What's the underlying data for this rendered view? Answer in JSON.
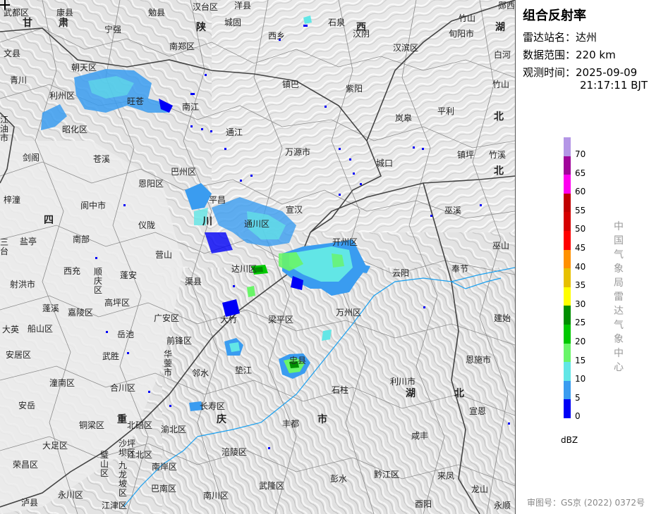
{
  "panel": {
    "title": "组合反射率",
    "station_label": "雷达站名：",
    "station_value": "达州",
    "range_label": "数据范围：",
    "range_value": "220 km",
    "time_label": "观测时间：",
    "time_date": "2025-09-09",
    "time_clock": "21:17:11 BJT",
    "unit": "dBZ",
    "org_vertical": "中国气象局雷达气象中心",
    "approval": "审图号：GS京 (2022) 0372号"
  },
  "legend": [
    {
      "label": "70",
      "color": "#b496e6"
    },
    {
      "label": "65",
      "color": "#a0059a"
    },
    {
      "label": "60",
      "color": "#ff00f0"
    },
    {
      "label": "55",
      "color": "#c00000"
    },
    {
      "label": "50",
      "color": "#d60000"
    },
    {
      "label": "45",
      "color": "#ff0000"
    },
    {
      "label": "40",
      "color": "#ff9000"
    },
    {
      "label": "35",
      "color": "#e7c000"
    },
    {
      "label": "30",
      "color": "#ffff00"
    },
    {
      "label": "25",
      "color": "#008e00"
    },
    {
      "label": "20",
      "color": "#00c800"
    },
    {
      "label": "15",
      "color": "#69f568"
    },
    {
      "label": "10",
      "color": "#62e6e6"
    },
    {
      "label": "5",
      "color": "#3a9cf0"
    },
    {
      "label": "0",
      "color": "#0000f6"
    }
  ],
  "map": {
    "province_labels": [
      {
        "id": "gan",
        "text": "甘"
      },
      {
        "id": "su",
        "text": "肃"
      },
      {
        "id": "shan",
        "text": "陕"
      },
      {
        "id": "xi",
        "text": "西"
      },
      {
        "id": "hu1",
        "text": "湖"
      },
      {
        "id": "bei1",
        "text": "北"
      },
      {
        "id": "bei2",
        "text": "北"
      },
      {
        "id": "si",
        "text": "四"
      },
      {
        "id": "chuan",
        "text": "川"
      },
      {
        "id": "hu2",
        "text": "湖"
      },
      {
        "id": "bei3",
        "text": "北"
      },
      {
        "id": "chong",
        "text": "重"
      },
      {
        "id": "qing",
        "text": "庆"
      },
      {
        "id": "shi",
        "text": "市"
      }
    ],
    "city_labels": [
      {
        "id": "wudu",
        "text": "武都区"
      },
      {
        "id": "kangxian",
        "text": "康县"
      },
      {
        "id": "mianxian",
        "text": "勉县"
      },
      {
        "id": "hantai",
        "text": "汉台区"
      },
      {
        "id": "yangxian",
        "text": "洋县"
      },
      {
        "id": "yunxi",
        "text": "郧西"
      },
      {
        "id": "ningqiang",
        "text": "宁强"
      },
      {
        "id": "chenggu",
        "text": "城固"
      },
      {
        "id": "shiquan",
        "text": "石泉"
      },
      {
        "id": "xunyang",
        "text": "旬阳市"
      },
      {
        "id": "wenxian",
        "text": "文县"
      },
      {
        "id": "nanzheng",
        "text": "南郑区"
      },
      {
        "id": "xixiang",
        "text": "西乡"
      },
      {
        "id": "hanyin",
        "text": "汉阴"
      },
      {
        "id": "hanbin",
        "text": "汉滨区"
      },
      {
        "id": "baihe",
        "text": "白河"
      },
      {
        "id": "qingchuan",
        "text": "青川"
      },
      {
        "id": "chaotian",
        "text": "朝天区"
      },
      {
        "id": "zhuxi",
        "text": "竹山"
      },
      {
        "id": "lizhou",
        "text": "利州区"
      },
      {
        "id": "wangcang",
        "text": "旺苍"
      },
      {
        "id": "nanjiang",
        "text": "南江"
      },
      {
        "id": "zhenba",
        "text": "镇巴"
      },
      {
        "id": "ziyang",
        "text": "紫阳"
      },
      {
        "id": "pingli",
        "text": "平利"
      },
      {
        "id": "zhaohua",
        "text": "昭化区"
      },
      {
        "id": "tongjiang",
        "text": "通江"
      },
      {
        "id": "langao",
        "text": "岚皋"
      },
      {
        "id": "jiangyou",
        "text": "江油市"
      },
      {
        "id": "jiange",
        "text": "剑阁"
      },
      {
        "id": "cangxi",
        "text": "苍溪"
      },
      {
        "id": "wanyuan",
        "text": "万源市"
      },
      {
        "id": "zhenping",
        "text": "镇坪"
      },
      {
        "id": "zhuxi2",
        "text": "竹溪"
      },
      {
        "id": "bazhou",
        "text": "巴州区"
      },
      {
        "id": "chengkou",
        "text": "城口"
      },
      {
        "id": "enyang",
        "text": "恩阳区"
      },
      {
        "id": "zitong",
        "text": "梓潼"
      },
      {
        "id": "langzhong",
        "text": "阆中市"
      },
      {
        "id": "pingchang",
        "text": "平昌"
      },
      {
        "id": "xuanhan",
        "text": "宣汉"
      },
      {
        "id": "wuxi",
        "text": "巫溪"
      },
      {
        "id": "yanting",
        "text": "盐亭"
      },
      {
        "id": "nanbu",
        "text": "南部"
      },
      {
        "id": "yilong",
        "text": "仪陇"
      },
      {
        "id": "tongchuan",
        "text": "通川区"
      },
      {
        "id": "kaizhou",
        "text": "开州区"
      },
      {
        "id": "wushan",
        "text": "巫山"
      },
      {
        "id": "santai",
        "text": "三台"
      },
      {
        "id": "yingshan",
        "text": "营山"
      },
      {
        "id": "dachuan",
        "text": "达川区"
      },
      {
        "id": "yunyang",
        "text": "云阳"
      },
      {
        "id": "fengjie",
        "text": "奉节"
      },
      {
        "id": "xichong",
        "text": "西充"
      },
      {
        "id": "shunqing",
        "text": "顺庆区"
      },
      {
        "id": "penggan",
        "text": "蓬安"
      },
      {
        "id": "quxian",
        "text": "渠县"
      },
      {
        "id": "shehong",
        "text": "射洪市"
      },
      {
        "id": "gaoping",
        "text": "高坪区"
      },
      {
        "id": "wanzhou",
        "text": "万州区"
      },
      {
        "id": "jianshi",
        "text": "建始"
      },
      {
        "id": "pengxi",
        "text": "蓬溪"
      },
      {
        "id": "jialing",
        "text": "嘉陵区"
      },
      {
        "id": "guang-an",
        "text": "广安区"
      },
      {
        "id": "dazhu",
        "text": "大竹"
      },
      {
        "id": "liangping",
        "text": "梁平区"
      },
      {
        "id": "daying",
        "text": "大英"
      },
      {
        "id": "chuanshan",
        "text": "船山区"
      },
      {
        "id": "yuechi",
        "text": "岳池"
      },
      {
        "id": "qianfeng",
        "text": "前锋区"
      },
      {
        "id": "anju",
        "text": "安居区"
      },
      {
        "id": "wusheng",
        "text": "武胜"
      },
      {
        "id": "huaying",
        "text": "华蓥市"
      },
      {
        "id": "linshui",
        "text": "邻水"
      },
      {
        "id": "dianjiang",
        "text": "垫江"
      },
      {
        "id": "zhongxian",
        "text": "忠县"
      },
      {
        "id": "enshi",
        "text": "恩施市"
      },
      {
        "id": "tongnan",
        "text": "潼南区"
      },
      {
        "id": "hechuan",
        "text": "合川区"
      },
      {
        "id": "shizhu",
        "text": "石柱"
      },
      {
        "id": "lichuan",
        "text": "利川市"
      },
      {
        "id": "anyue",
        "text": "安岳"
      },
      {
        "id": "changshou",
        "text": "长寿区"
      },
      {
        "id": "xuanen",
        "text": "宣恩"
      },
      {
        "id": "tongliang",
        "text": "铜梁区"
      },
      {
        "id": "beibei",
        "text": "北碚区"
      },
      {
        "id": "fengdu",
        "text": "丰都"
      },
      {
        "id": "xianfeng",
        "text": "咸丰"
      },
      {
        "id": "yubei",
        "text": "渝北区"
      },
      {
        "id": "dazu",
        "text": "大足区"
      },
      {
        "id": "shapingba",
        "text": "沙坪坝区"
      },
      {
        "id": "rongchang",
        "text": "荣昌区"
      },
      {
        "id": "bishan",
        "text": "璧山区"
      },
      {
        "id": "jiulongpo",
        "text": "九龙坡区"
      },
      {
        "id": "fuling",
        "text": "涪陵区"
      },
      {
        "id": "qianjiang",
        "text": "黔江区"
      },
      {
        "id": "laifeng",
        "text": "来凤"
      },
      {
        "id": "nanan",
        "text": "南岸区"
      },
      {
        "id": "wulong",
        "text": "武隆区"
      },
      {
        "id": "pengshui",
        "text": "彭水"
      },
      {
        "id": "longshan",
        "text": "龙山"
      },
      {
        "id": "yongchuan",
        "text": "永川区"
      },
      {
        "id": "banan",
        "text": "巴南区"
      },
      {
        "id": "nanchuan",
        "text": "南川区"
      },
      {
        "id": "youyang",
        "text": "酉阳"
      },
      {
        "id": "jiangjin",
        "text": "江津区"
      },
      {
        "id": "luxian",
        "text": "泸县"
      },
      {
        "id": "yongshun",
        "text": "永顺"
      },
      {
        "id": "zhuxi3",
        "text": "竹山"
      },
      {
        "id": "jiangbei",
        "text": "江北区"
      }
    ]
  }
}
